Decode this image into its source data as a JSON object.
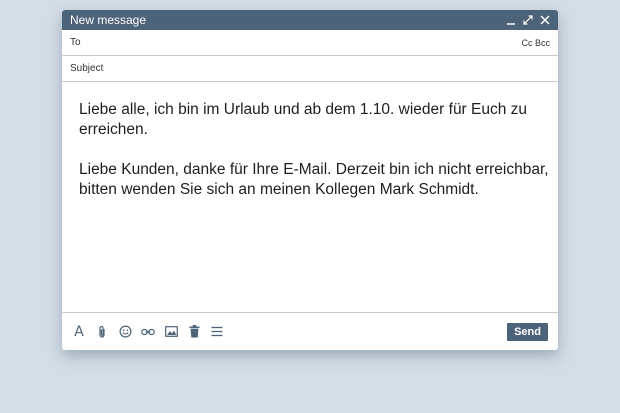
{
  "window": {
    "title": "New message",
    "icons": [
      "minimize-icon",
      "expand-icon",
      "close-icon"
    ]
  },
  "to": {
    "label": "To",
    "value": "",
    "cc_bcc": "Cc Bcc"
  },
  "subject": {
    "label": "Subject",
    "value": ""
  },
  "body": {
    "text": "Liebe alle, ich bin im Urlaub und ab dem 1.10. wieder für Euch zu erreichen.\n\nLiebe Kunden, danke für Ihre E-Mail. Derzeit bin ich nicht erreichbar, bitten wenden Sie sich an meinen Kollegen Mark Schmidt."
  },
  "toolbar": {
    "format_glyph": "A",
    "tools": [
      "format-text-icon",
      "attach-icon",
      "emoji-icon",
      "link-icon",
      "image-icon",
      "trash-icon",
      "more-options-icon"
    ],
    "send_label": "Send"
  },
  "colors": {
    "background": "#d3dde6",
    "accent": "#4d6379",
    "divider": "#c5cbd1"
  }
}
